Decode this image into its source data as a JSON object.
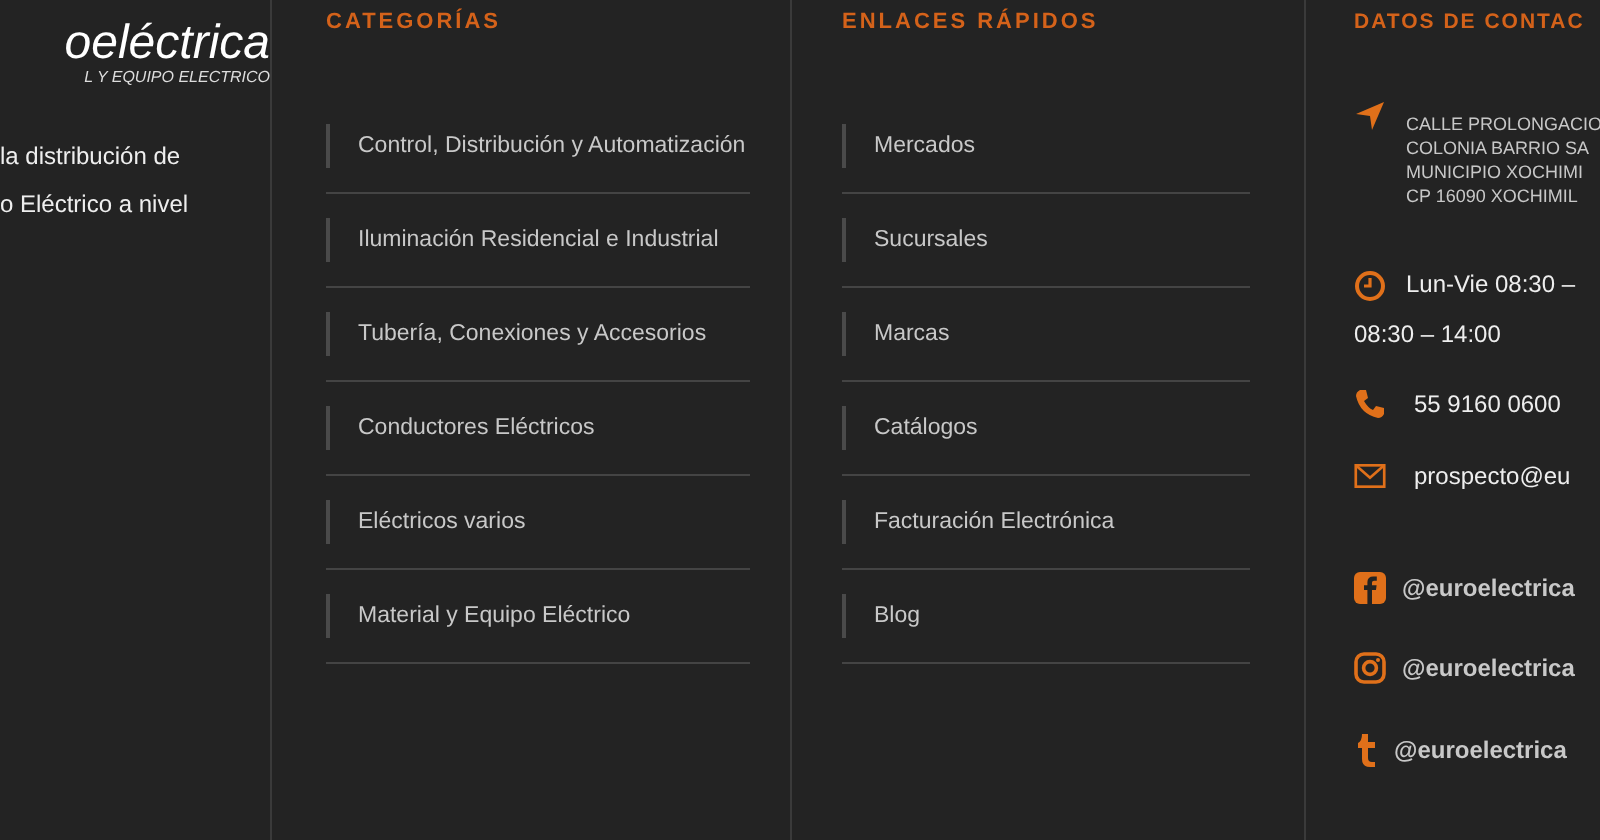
{
  "brand": {
    "logo_text": "oeléctrica",
    "logo_subtitle": "L Y EQUIPO ELECTRICO",
    "about_lines": [
      "la distribución de",
      "o Eléctrico a nivel"
    ]
  },
  "categories": {
    "title": "CATEGORÍAS",
    "items": [
      "Control, Distribución y Automatización",
      "Iluminación Residencial e Industrial",
      "Tubería, Conexiones y Accesorios",
      "Conductores Eléctricos",
      "Eléctricos varios",
      "Material y Equipo Eléctrico"
    ]
  },
  "quick_links": {
    "title": "ENLACES RÁPIDOS",
    "items": [
      "Mercados",
      "Sucursales",
      "Marcas",
      "Catálogos",
      "Facturación Electrónica",
      "Blog"
    ]
  },
  "contact": {
    "title": "DATOS DE CONTAC",
    "address_lines": [
      "CALLE PROLONGACIO",
      "COLONIA BARRIO SA",
      "MUNICIPIO XOCHIMI",
      "CP 16090  XOCHIMIL"
    ],
    "hours_lines": [
      "Lun-Vie 08:30 –",
      "08:30 – 14:00"
    ],
    "phone": "55 9160 0600",
    "email": "prospecto@eu",
    "social": [
      {
        "kind": "facebook",
        "handle": "@euroelectrica"
      },
      {
        "kind": "instagram",
        "handle": "@euroelectrica"
      },
      {
        "kind": "tumblr",
        "handle": "@euroelectrica"
      }
    ]
  }
}
